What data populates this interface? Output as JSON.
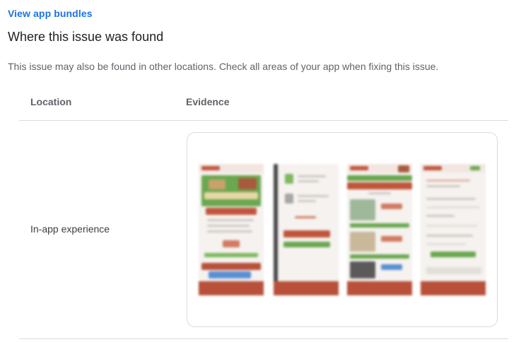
{
  "links": {
    "view_app_bundles": "View app bundles"
  },
  "section": {
    "title": "Where this issue was found",
    "description": "This issue may also be found in other locations. Check all areas of your app when fixing this issue."
  },
  "table": {
    "columns": [
      "Location",
      "Evidence"
    ],
    "rows": [
      {
        "location": "In-app experience",
        "evidence": {
          "screenshots": 4
        }
      }
    ]
  },
  "colors": {
    "link": "#1a73e8",
    "border": "#dadce0",
    "app_header_red": "#c0553c",
    "app_green": "#5aa83c",
    "app_brown": "#a85a3c"
  }
}
